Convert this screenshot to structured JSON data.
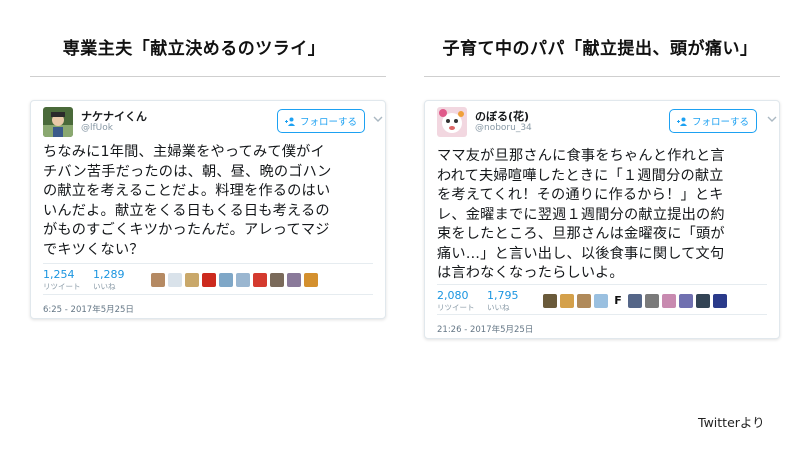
{
  "slides": {
    "left_title": "専業主夫「献立決めるのツライ」",
    "right_title": "子育て中のパパ「献立提出、頭が痛い」",
    "source": "Twitterより"
  },
  "tweet1": {
    "name": "ナケナイくん",
    "handle": "@lfUok",
    "follow_label": "フォローする",
    "text_lines": [
      "ちなみに1年間、主婦業をやってみて僕がイ",
      "チバン苦手だったのは、朝、昼、晩のゴハン",
      "の献立を考えることだよ。料理を作るのはい",
      "いんだよ。献立をくる日もくる日も考えるの",
      "がものすごくキツかったんだ。アレってマジ",
      "でキツくない？"
    ],
    "retweets": "1,254",
    "retweets_label": "リツイート",
    "likes": "1,289",
    "likes_label": "いいね",
    "timestamp": "6:25 - 2017年5月25日",
    "liker_colors": [
      "#b58a63",
      "#d9e2ea",
      "#c9a86a",
      "#cc2a1e",
      "#7fa7c7",
      "#9ab6d0",
      "#d43a2e",
      "#7a6a5a",
      "#8a7a9a",
      "#d4902e"
    ]
  },
  "tweet2": {
    "name": "のぼる(花)",
    "handle": "@noboru_34",
    "follow_label": "フォローする",
    "text_lines": [
      "ママ友が旦那さんに食事をちゃんと作れと言",
      "われて夫婦喧嘩したときに「１週間分の献立",
      "を考えてくれ！その通りに作るから！」とキ",
      "レ、金曜までに翌週１週間分の献立提出の約",
      "束をしたところ、旦那さんは金曜夜に「頭が",
      "痛い…」と言い出し、以後食事に関して文句",
      "は言わなくなったらしいよ。"
    ],
    "retweets": "2,080",
    "retweets_label": "リツイート",
    "likes": "1,795",
    "likes_label": "いいね",
    "timestamp": "21:26 - 2017年5月25日",
    "liker_mark": "F",
    "liker_colors": [
      "#6a5a3a",
      "#d4a04a",
      "#b08a5a",
      "#9ac0e0",
      "#556688",
      "#7a7a7a",
      "#c88ab0",
      "#7070b0",
      "#334455",
      "#2a3a8a"
    ]
  }
}
